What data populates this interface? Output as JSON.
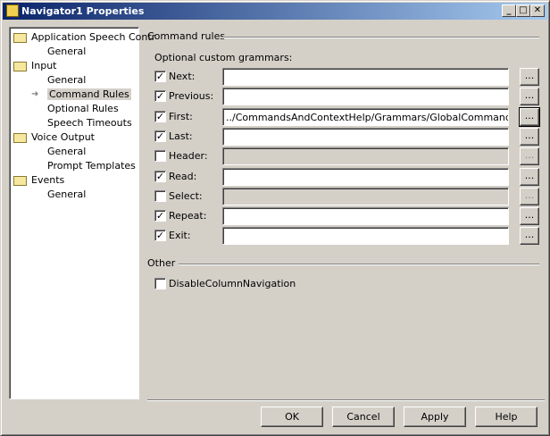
{
  "window": {
    "title": "Navigator1 Properties",
    "minimize": "_",
    "maximize": "□",
    "close": "✕"
  },
  "tree": [
    {
      "label": "Application Speech Contr",
      "level": 0
    },
    {
      "label": "General",
      "level": 1
    },
    {
      "label": "Input",
      "level": 0
    },
    {
      "label": "General",
      "level": 1
    },
    {
      "label": "Command Rules",
      "level": 1,
      "selected": true
    },
    {
      "label": "Optional Rules",
      "level": 1
    },
    {
      "label": "Speech Timeouts",
      "level": 1
    },
    {
      "label": "Voice Output",
      "level": 0
    },
    {
      "label": "General",
      "level": 1
    },
    {
      "label": "Prompt Templates",
      "level": 1
    },
    {
      "label": "Events",
      "level": 0
    },
    {
      "label": "General",
      "level": 1
    }
  ],
  "command_rules": {
    "heading": "Command rules",
    "subheading": "Optional custom grammars:",
    "browse_label": "...",
    "rows": [
      {
        "label": "Next:",
        "checked": true,
        "value": ""
      },
      {
        "label": "Previous:",
        "checked": true,
        "value": ""
      },
      {
        "label": "First:",
        "checked": true,
        "value": "../CommandsAndContextHelp/Grammars/GlobalCommands.grxml#"
      },
      {
        "label": "Last:",
        "checked": true,
        "value": ""
      },
      {
        "label": "Header:",
        "checked": false,
        "value": ""
      },
      {
        "label": "Read:",
        "checked": true,
        "value": ""
      },
      {
        "label": "Select:",
        "checked": false,
        "value": ""
      },
      {
        "label": "Repeat:",
        "checked": true,
        "value": ""
      },
      {
        "label": "Exit:",
        "checked": true,
        "value": ""
      }
    ]
  },
  "other": {
    "heading": "Other",
    "disable_column_navigation": {
      "label": "DisableColumnNavigation",
      "checked": false
    }
  },
  "buttons": {
    "ok": "OK",
    "cancel": "Cancel",
    "apply": "Apply",
    "help": "Help"
  }
}
